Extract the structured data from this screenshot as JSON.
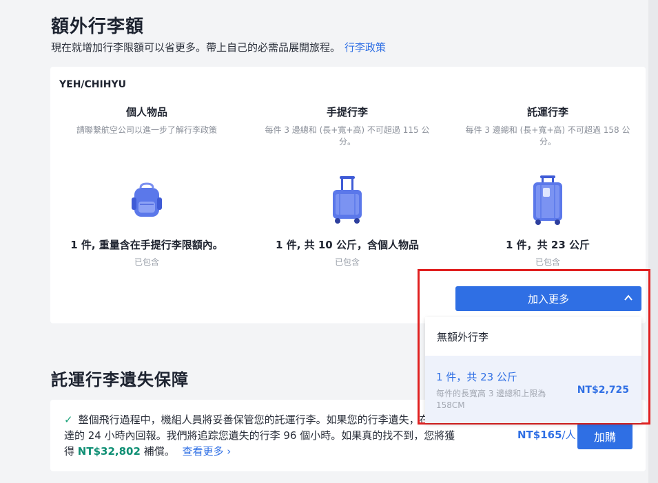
{
  "section1": {
    "title": "額外行李額",
    "subtitle": "現在就增加行李限額可以省更多。帶上自己的必需品展開旅程。",
    "policy_link": "行李政策"
  },
  "passenger": "YEH/CHIHYU",
  "columns": [
    {
      "title": "個人物品",
      "desc": "請聯繫航空公司以進一步了解行李政策",
      "icon": "backpack-icon",
      "amount": "1 件, 重量含在手提行李限額內。",
      "included": "已包含"
    },
    {
      "title": "手提行李",
      "desc": "每件 3 邊總和 (長+寬+高) 不可超過 115 公分。",
      "icon": "carry-on-suitcase-icon",
      "amount": "1 件, 共 10 公斤，含個人物品",
      "included": "已包含"
    },
    {
      "title": "託運行李",
      "desc": "每件 3 邊總和 (長+寬+高) 不可超過 158 公分。",
      "icon": "checked-suitcase-icon",
      "amount": "1 件，共 23 公斤",
      "included": "已包含"
    }
  ],
  "add_more": {
    "label": "加入更多",
    "options": {
      "none_label": "無額外行李",
      "option1_title": "1 件，共 23 公斤",
      "option1_desc": "每件的長寬高 3 邊總和上限為 158CM",
      "option1_price": "NT$2,725"
    }
  },
  "section2": {
    "title": "託運行李遺失保障",
    "text_before": "整個飛行過程中，機組人員將妥善保管您的託運行李。如果您的行李遺失，在班機抵達的 24 小時內回報。我們將追踪您遺失的行李 96 個小時。如果真的找不到，您將獲得",
    "amount": "NT$32,802",
    "text_after": "補償。",
    "more_link": "查看更多",
    "price": "NT$165",
    "per": "/人",
    "buy_label": "加購"
  },
  "colors": {
    "accent": "#2f6fe4",
    "highlight_border": "#e02020",
    "success": "#1aa37a"
  }
}
